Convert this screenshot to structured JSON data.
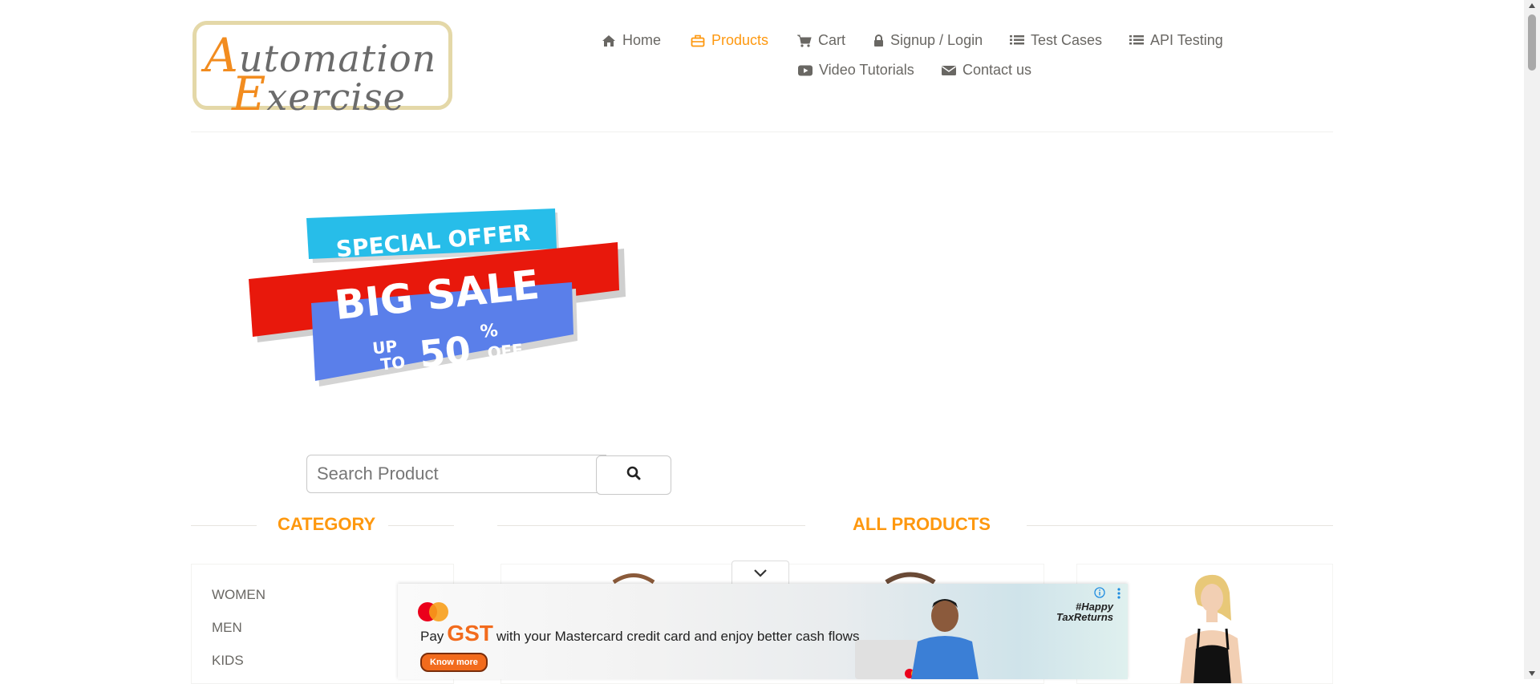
{
  "logo": {
    "line1_cap": "A",
    "line1_rest": "utomation",
    "line2_cap": "E",
    "line2_rest": "xercise"
  },
  "nav": {
    "items": [
      {
        "label": "Home",
        "icon": "home-icon",
        "active": false
      },
      {
        "label": "Products",
        "icon": "briefcase-icon",
        "active": true
      },
      {
        "label": "Cart",
        "icon": "cart-icon",
        "active": false
      },
      {
        "label": "Signup / Login",
        "icon": "lock-icon",
        "active": false
      },
      {
        "label": "Test Cases",
        "icon": "list-icon",
        "active": false
      },
      {
        "label": "API Testing",
        "icon": "list-icon",
        "active": false
      },
      {
        "label": "Video Tutorials",
        "icon": "youtube-icon",
        "active": false
      },
      {
        "label": "Contact us",
        "icon": "envelope-icon",
        "active": false
      }
    ]
  },
  "banner": {
    "special_offer": "SPECIAL OFFER",
    "big_sale": "BIG SALE",
    "up": "UP",
    "to": "TO",
    "percent": "50",
    "percent_sign": "%",
    "off": "OFF"
  },
  "search": {
    "placeholder": "Search Product",
    "value": "",
    "button_icon": "search-icon"
  },
  "sections": {
    "category_title": "CATEGORY",
    "products_title": "ALL PRODUCTS"
  },
  "categories": [
    {
      "label": "WOMEN"
    },
    {
      "label": "MEN"
    },
    {
      "label": "KIDS"
    }
  ],
  "ad": {
    "line_pay": "Pay",
    "line_gst": "GST",
    "line_rest": "with your Mastercard credit card and enjoy better cash flows",
    "button": "Know more",
    "tag_line1": "#Happy",
    "tag_line2": "TaxReturns"
  },
  "colors": {
    "accent": "#fe980f",
    "nav_text": "#696763",
    "ad_orange": "#f26b1d"
  }
}
